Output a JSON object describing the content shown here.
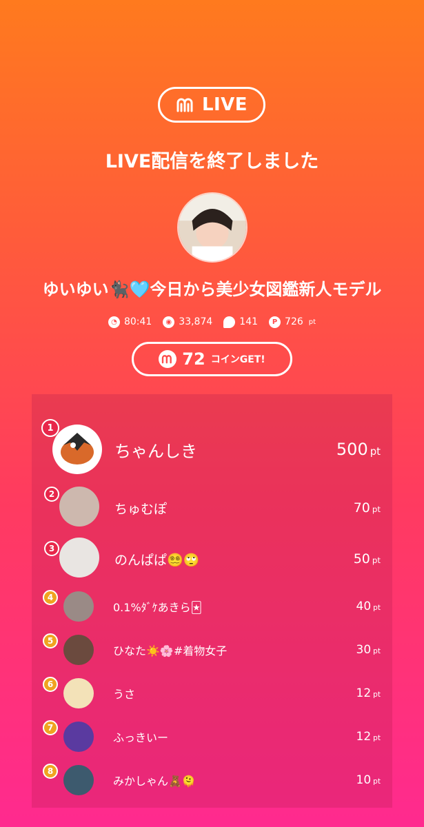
{
  "header": {
    "live_label": "LIVE",
    "title": "LIVE配信を終了しました"
  },
  "host": {
    "name": "ゆいゆい🐈‍⬛🩵今日から美少女図鑑新人モデル"
  },
  "stats": {
    "duration": "80:41",
    "viewers": "33,874",
    "comments": "141",
    "points": "726",
    "points_unit": "pt"
  },
  "coins": {
    "count": "72",
    "label": "コインGET!"
  },
  "colors": {
    "rank_top": "#e8264a",
    "rank_low": "#f0a320"
  },
  "ranking": [
    {
      "rank": "1",
      "name": "ちゃんしき",
      "points": "500",
      "unit": "pt"
    },
    {
      "rank": "2",
      "name": "ちゅむぽ",
      "points": "70",
      "unit": "pt"
    },
    {
      "rank": "3",
      "name": "のんぱぱ😵‍💫🙄",
      "points": "50",
      "unit": "pt"
    },
    {
      "rank": "4",
      "name": "0.1%ﾀﾞｹあきら🃏",
      "points": "40",
      "unit": "pt"
    },
    {
      "rank": "5",
      "name": "ひなた☀️🌸#着物女子",
      "points": "30",
      "unit": "pt"
    },
    {
      "rank": "6",
      "name": "うさ",
      "points": "12",
      "unit": "pt"
    },
    {
      "rank": "7",
      "name": "ふっきいー",
      "points": "12",
      "unit": "pt"
    },
    {
      "rank": "8",
      "name": "みかしゃん🧸🫠",
      "points": "10",
      "unit": "pt"
    }
  ]
}
